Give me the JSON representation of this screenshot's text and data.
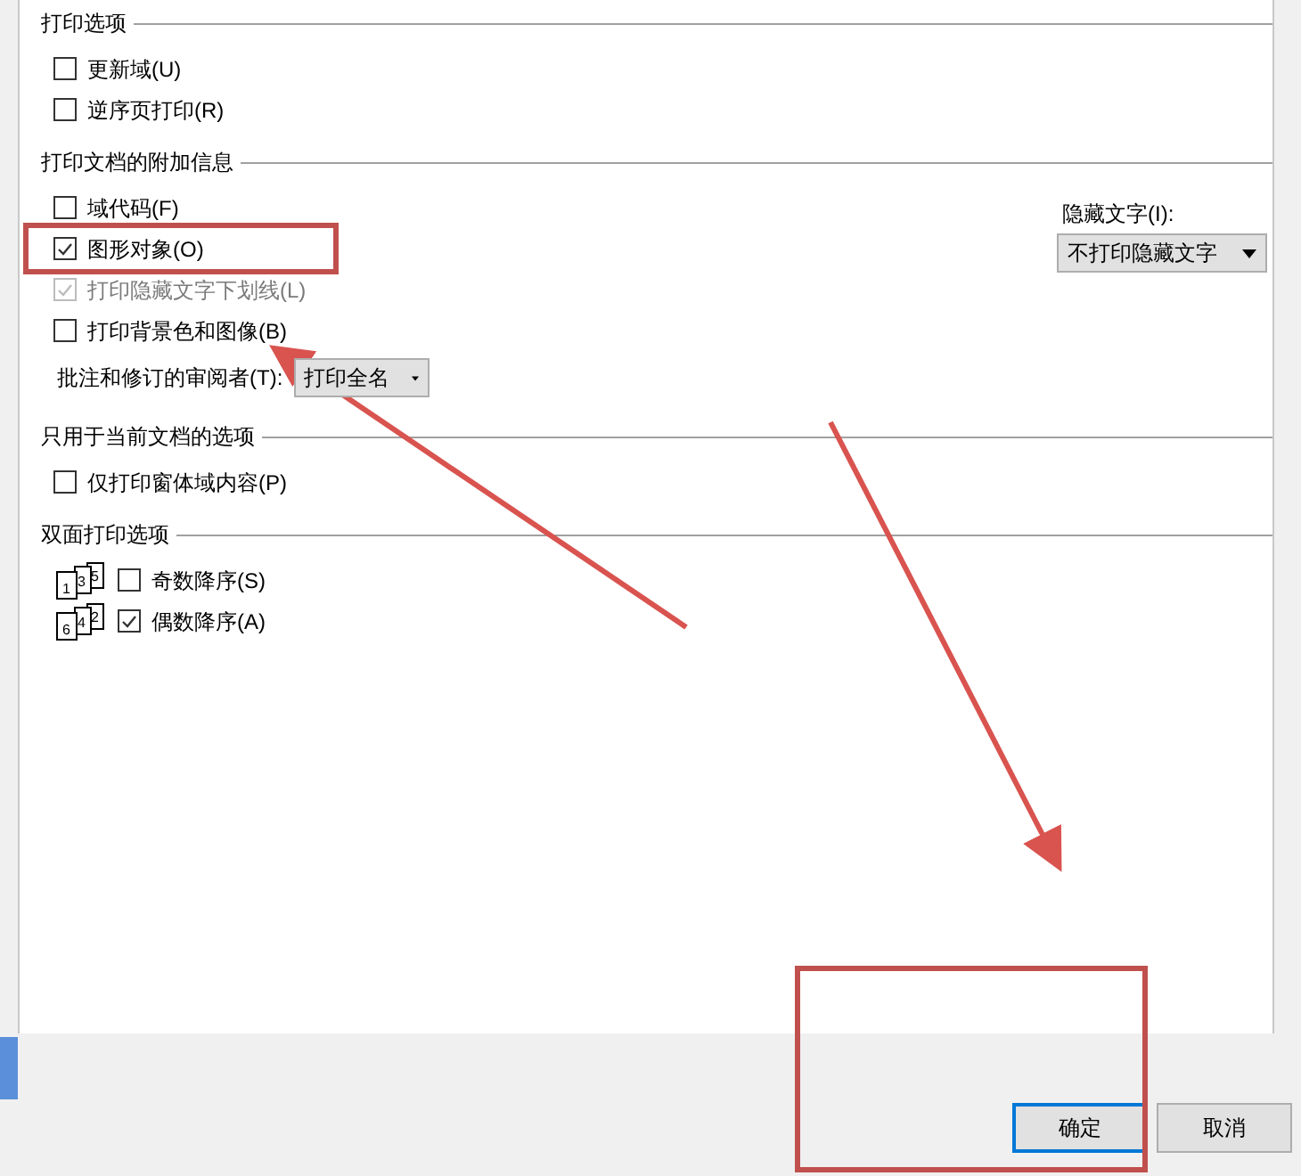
{
  "sections": [
    {
      "title": "打印选项",
      "items": [
        {
          "label": "更新域(U)",
          "checked": false,
          "disabled": false
        },
        {
          "label": "逆序页打印(R)",
          "checked": false,
          "disabled": false
        }
      ]
    },
    {
      "title": "打印文档的附加信息",
      "items": [
        {
          "label": "域代码(F)",
          "checked": false,
          "disabled": false
        },
        {
          "label": "图形对象(O)",
          "checked": true,
          "disabled": false
        },
        {
          "label": "打印隐藏文字下划线(L)",
          "checked": true,
          "disabled": true
        },
        {
          "label": "打印背景色和图像(B)",
          "checked": false,
          "disabled": false
        }
      ],
      "reviewer": {
        "label": "批注和修订的审阅者(T):",
        "value": "打印全名"
      },
      "hidden_text": {
        "label": "隐藏文字(I):",
        "value": "不打印隐藏文字"
      }
    },
    {
      "title": "只用于当前文档的选项",
      "items": [
        {
          "label": "仅打印窗体域内容(P)",
          "checked": false,
          "disabled": false
        }
      ]
    },
    {
      "title": "双面打印选项",
      "items": [
        {
          "label": "奇数降序(S)",
          "checked": false,
          "disabled": false,
          "pages": [
            "1",
            "3",
            "5"
          ]
        },
        {
          "label": "偶数降序(A)",
          "checked": true,
          "disabled": false,
          "pages": [
            "6",
            "4",
            "2"
          ]
        }
      ]
    }
  ],
  "buttons": [
    {
      "label": "确定",
      "selected": true
    },
    {
      "label": "取消",
      "selected": false
    }
  ]
}
